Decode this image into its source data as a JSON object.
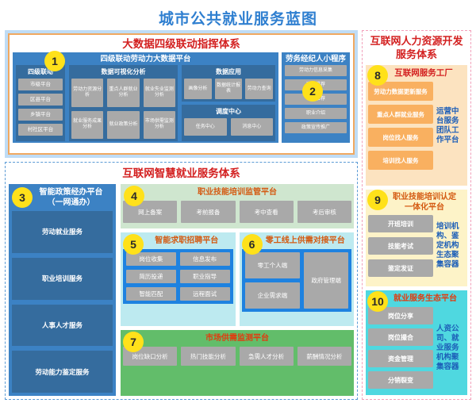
{
  "title": "城市公共就业服务蓝图",
  "colors": {
    "title_blue": "#2f7fd0",
    "heading_red": "#d32020",
    "heading_orange": "#d45a12",
    "badge_yellow": "#ffe11a",
    "panel_blue": "#3c82c4",
    "chip_gray": "#a9a9a9"
  },
  "section_a": {
    "title": "大数据四级联动指挥体系",
    "platform_title": "四级联动劳动力大数据平台",
    "badge_1": "1",
    "badge_2": "2",
    "linkage": {
      "title": "四级联动",
      "items": [
        "市级平台",
        "区县平台",
        "乡镇平台",
        "村社区平台"
      ]
    },
    "visualization": {
      "title": "数据可视化分析",
      "items": [
        "劳动力资源分析",
        "重点人群就业分析",
        "就业失业监测分析",
        "就业服务成果分析",
        "就业政策分析",
        "市场供需监测分析"
      ]
    },
    "data_application": {
      "title": "数据应用",
      "items": [
        "画像分析",
        "数据统计报表",
        "劳动力查询"
      ]
    },
    "dispatch_center": {
      "title": "调度中心",
      "items": [
        "任务中心",
        "消息中心"
      ]
    },
    "agent_miniprogram": {
      "title": "劳务经纪人小程序",
      "items": [
        "劳动力信息采集",
        "岗位推荐",
        "培训推荐",
        "职业介绍",
        "政策宣传推广"
      ]
    }
  },
  "section_b": {
    "title": "互联网智慧就业服务体系",
    "policy": {
      "badge": "3",
      "title": "智能政策经办平台\n（一网通办）",
      "title_line1": "智能政策经办平台",
      "title_line2": "（一网通办）",
      "items": [
        "劳动就业服务",
        "职业培训服务",
        "人事人才服务",
        "劳动能力鉴定服务"
      ]
    },
    "training_supervision": {
      "badge": "4",
      "title": "职业技能培训监管平台",
      "items": [
        "网上备案",
        "考前报备",
        "考中查看",
        "考后审核"
      ]
    },
    "job_matching": {
      "badge": "5",
      "title": "智能求职招聘平台",
      "items": [
        "岗位收集",
        "信息发布",
        "简历投递",
        "职业指导",
        "智能匹配",
        "远程面试"
      ]
    },
    "gig_platform": {
      "badge": "6",
      "title": "零工线上供需对接平台",
      "items": [
        "零工个人端",
        "企业需求端",
        "政府管理端"
      ]
    },
    "market_monitor": {
      "badge": "7",
      "title": "市场供需监测平台",
      "items": [
        "岗位缺口分析",
        "热门技能分析",
        "急需人才分析",
        "薪酬情况分析"
      ]
    }
  },
  "section_c": {
    "title": "互联网人力资源开发服务体系",
    "service_factory": {
      "badge": "8",
      "title": "互联网服务工厂",
      "items": [
        "劳动力数据更新服务",
        "重点人群就业服务",
        "岗位找人服务",
        "培训找人服务"
      ],
      "side_label": "运营中台服务团队工作平台"
    },
    "skill_certification": {
      "badge": "9",
      "title": "职业技能培训认定一体化平台",
      "title_line1": "职业技能培训认定",
      "title_line2": "一体化平台",
      "items": [
        "开班培训",
        "技能考试",
        "鉴定发证"
      ],
      "side_label": "培训机构、鉴定机构生态聚集容器"
    },
    "ecosystem": {
      "badge": "10",
      "title": "就业服务生态平台",
      "items": [
        "岗位分享",
        "岗位撮合",
        "资金管理",
        "分销裂变"
      ],
      "side_label": "人资公司、就业服务机构聚集容器"
    }
  }
}
